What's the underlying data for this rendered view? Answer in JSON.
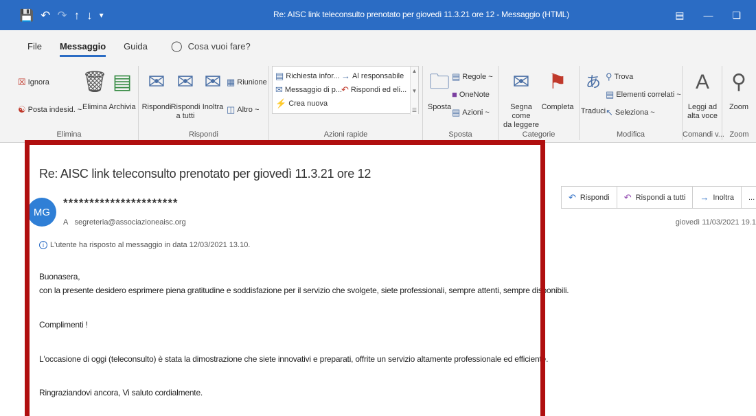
{
  "window": {
    "title": "Re: AISC link teleconsulto prenotato per giovedì 11.3.21 ore 12  -  Messaggio (HTML)"
  },
  "quick_access": {
    "save_icon": "save-icon",
    "undo_icon": "undo-icon",
    "redo_icon": "redo-icon"
  },
  "tabs": [
    {
      "label": "File"
    },
    {
      "label": "Messaggio"
    },
    {
      "label": "Guida"
    }
  ],
  "tell_me": {
    "placeholder": "Cosa vuoi fare?"
  },
  "ribbon": {
    "elimina": {
      "label": "Elimina",
      "ignora": "Ignora",
      "posta_indesid": "Posta indesid. ~",
      "elimina_btn": "Elimina",
      "archivia": "Archivia"
    },
    "rispondi": {
      "label": "Rispondi",
      "rispondi_btn": "Rispondi",
      "rispondi_tutti_1": "Rispondi",
      "rispondi_tutti_2": "a tutti",
      "inoltra": "Inoltra",
      "riunione": "Riunione",
      "altro": "Altro ~"
    },
    "azioni_rapide": {
      "label": "Azioni rapide",
      "items": [
        "Richiesta infor...",
        "Al responsabile",
        "Messaggio di p...",
        "Rispondi ed eli...",
        "Crea nuova"
      ]
    },
    "sposta": {
      "label": "Sposta",
      "sposta_btn": "Sposta",
      "regole": "Regole ~",
      "onenote": "OneNote",
      "azioni": "Azioni ~"
    },
    "categorie": {
      "label": "Categorie",
      "segna_1": "Segna come",
      "segna_2": "da leggere",
      "completa": "Completa"
    },
    "modifica": {
      "label": "Modifica",
      "traduci": "Traduci",
      "trova": "Trova",
      "elementi": "Elementi correlati ~",
      "seleziona": "Seleziona ~"
    },
    "comandi": {
      "label": "Comandi v...",
      "leggi_1": "Leggi ad",
      "leggi_2": "alta voce"
    },
    "zoom": {
      "label": "Zoom",
      "zoom_btn": "Zoom"
    }
  },
  "message": {
    "subject": "Re: AISC link teleconsulto prenotato per giovedì 11.3.21 ore 12",
    "avatar_initials": "MG",
    "sender": "**********************",
    "to_prefix": "A",
    "to_address": "segreteria@associazioneaisc.org",
    "info": "L'utente ha risposto al messaggio in data 12/03/2021 13.10.",
    "date": "giovedì 11/03/2021 19.1",
    "body": [
      "Buonasera,",
      "con la presente desidero esprimere piena gratitudine e soddisfazione per il servizio che svolgete, siete professionali, sempre attenti, sempre disponibili.",
      "Complimenti !",
      "L'occasione di oggi (teleconsulto) è stata la dimostrazione che siete innovativi e preparati, offrite un servizio altamente professionale ed efficiente.",
      "Ringraziandovi ancora, Vi saluto cordialmente."
    ]
  },
  "actions": {
    "reply": "Rispondi",
    "reply_all": "Rispondi a tutti",
    "forward": "Inoltra",
    "more": "..."
  },
  "colors": {
    "titlebar": "#2b6cc4",
    "highlight_frame": "#b00f0f",
    "avatar": "#2f7fd6"
  }
}
